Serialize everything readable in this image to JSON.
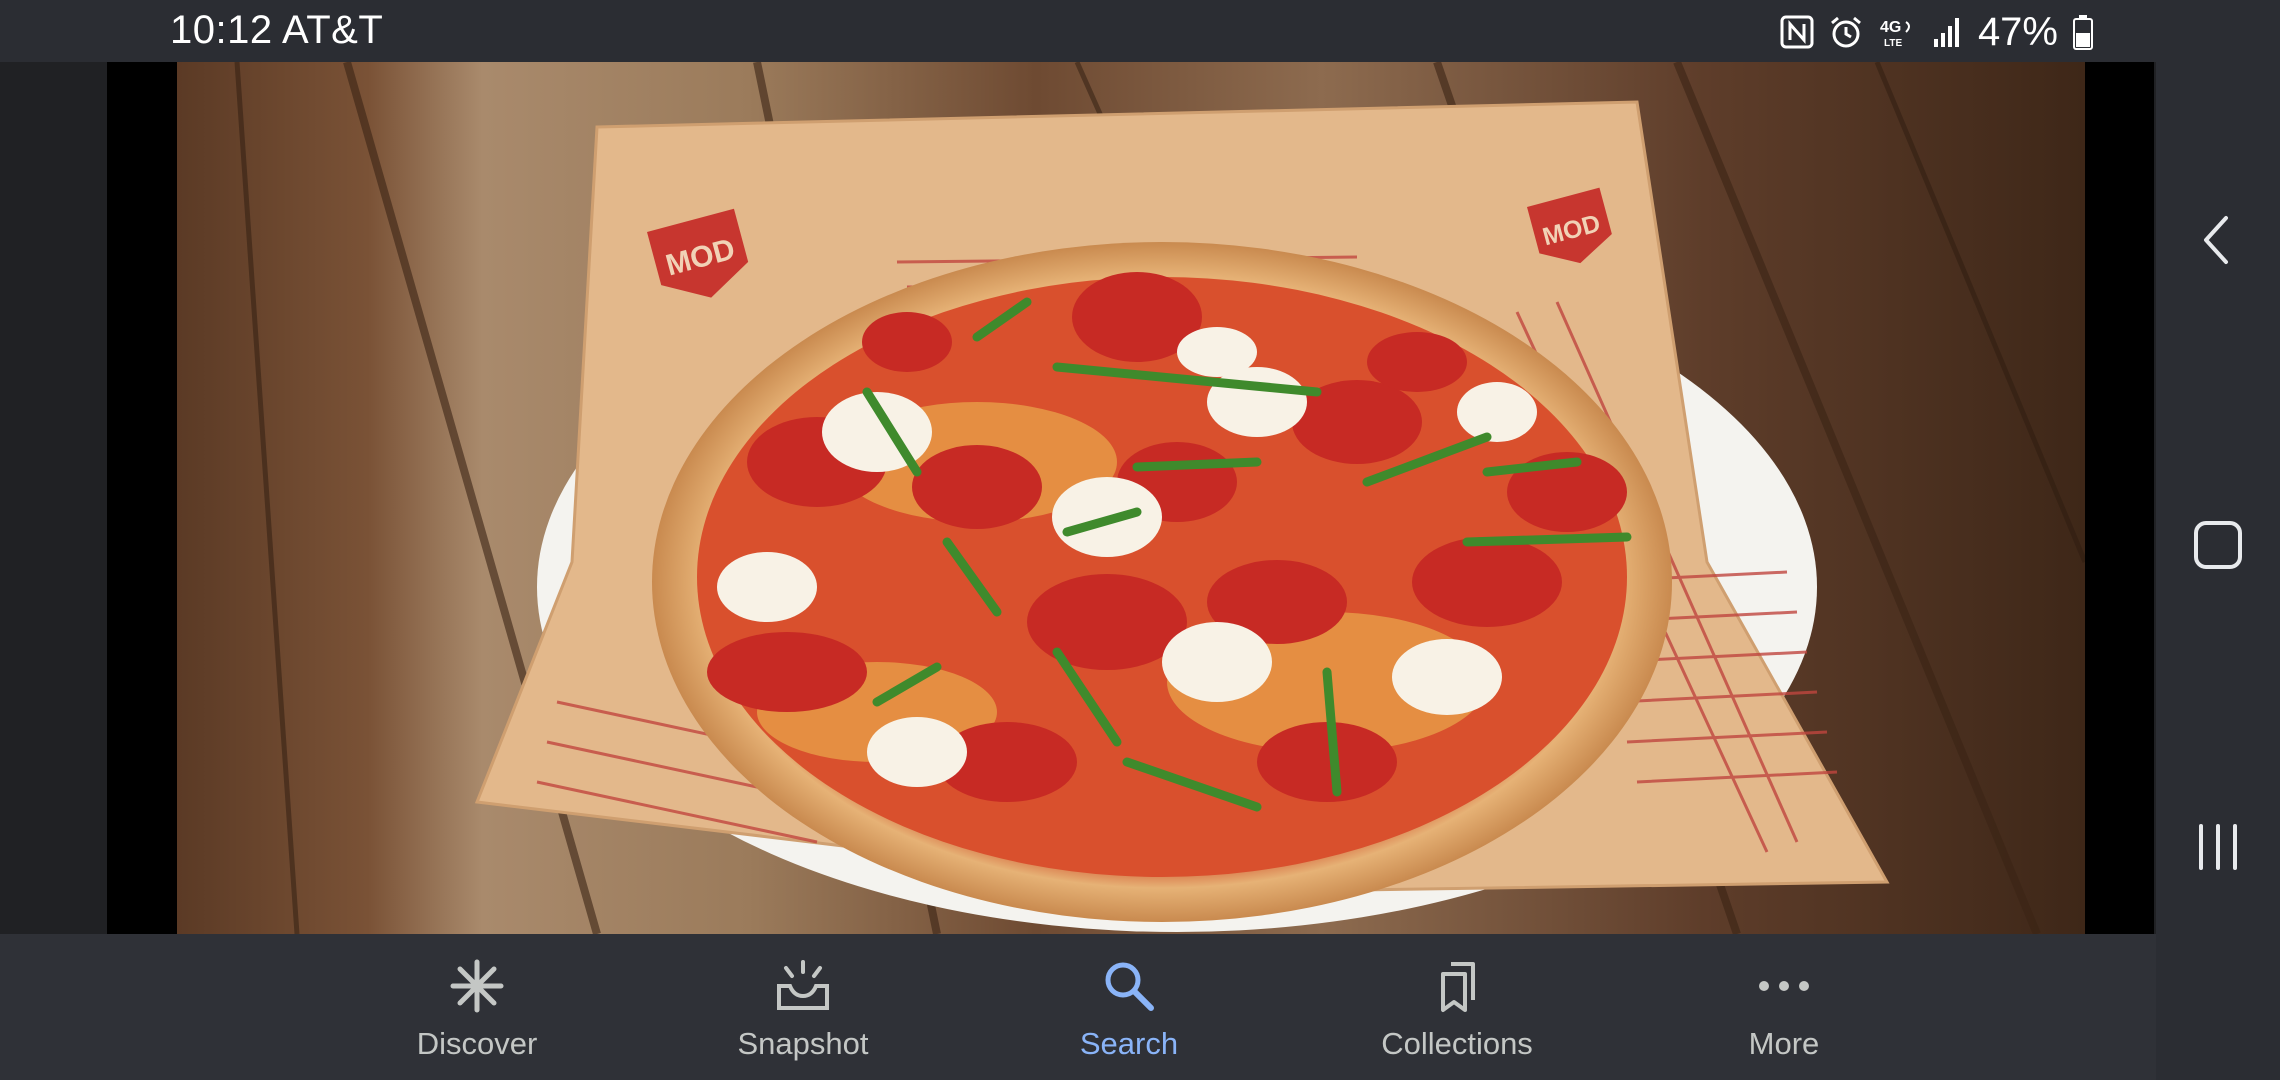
{
  "status_bar": {
    "time": "10:12 AT&T",
    "battery": "47%",
    "icons": [
      "nfc-icon",
      "alarm-icon",
      "4g-lte-icon",
      "signal-icon",
      "battery-icon"
    ]
  },
  "image": {
    "logo_text": "MOD",
    "description_icon": "pizza-photo"
  },
  "bottom_nav": {
    "items": [
      {
        "label": "Discover",
        "icon": "asterisk-icon"
      },
      {
        "label": "Snapshot",
        "icon": "snapshot-icon"
      },
      {
        "label": "Search",
        "icon": "search-icon",
        "active": true
      },
      {
        "label": "Collections",
        "icon": "collections-icon"
      },
      {
        "label": "More",
        "icon": "more-icon"
      }
    ]
  },
  "system_nav": {
    "buttons": [
      "back-icon",
      "home-icon",
      "recents-icon"
    ]
  },
  "colors": {
    "bar_bg": "#2b2d33",
    "nav_bg": "#2f3137",
    "active": "#8ab4f8",
    "inactive": "#c4c7c5"
  }
}
